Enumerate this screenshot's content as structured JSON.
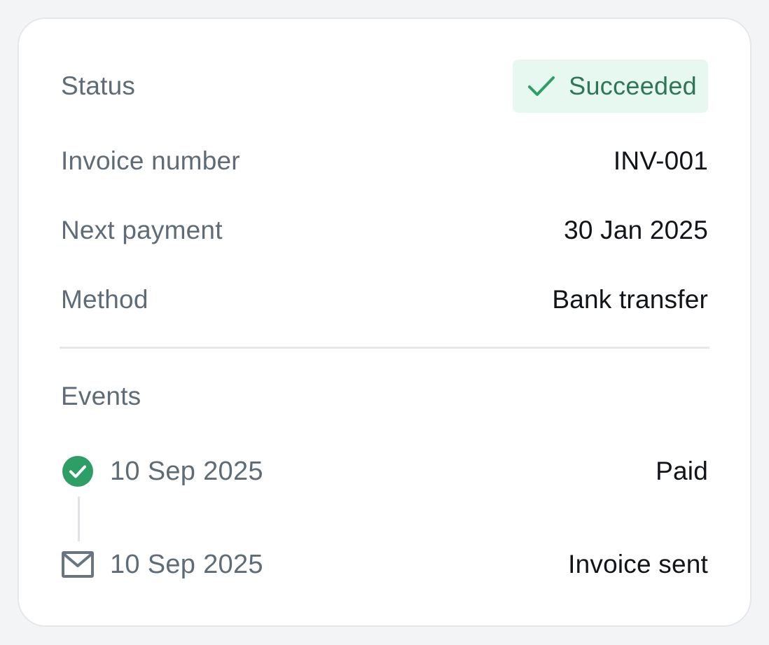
{
  "details": {
    "status_label": "Status",
    "status_value": "Succeeded",
    "invoice_label": "Invoice number",
    "invoice_value": "INV-001",
    "next_payment_label": "Next payment",
    "next_payment_value": "30 Jan 2025",
    "method_label": "Method",
    "method_value": "Bank transfer"
  },
  "events": {
    "heading": "Events",
    "items": [
      {
        "date": "10 Sep 2025",
        "label": "Paid",
        "icon": "check-circle-icon"
      },
      {
        "date": "10 Sep 2025",
        "label": "Invoice sent",
        "icon": "envelope-icon"
      }
    ]
  },
  "colors": {
    "success_green": "#2e9e67",
    "badge_background": "#e6f8ef",
    "badge_text": "#2f7559",
    "muted_text": "#5f6b76",
    "strong_text": "#111418"
  }
}
